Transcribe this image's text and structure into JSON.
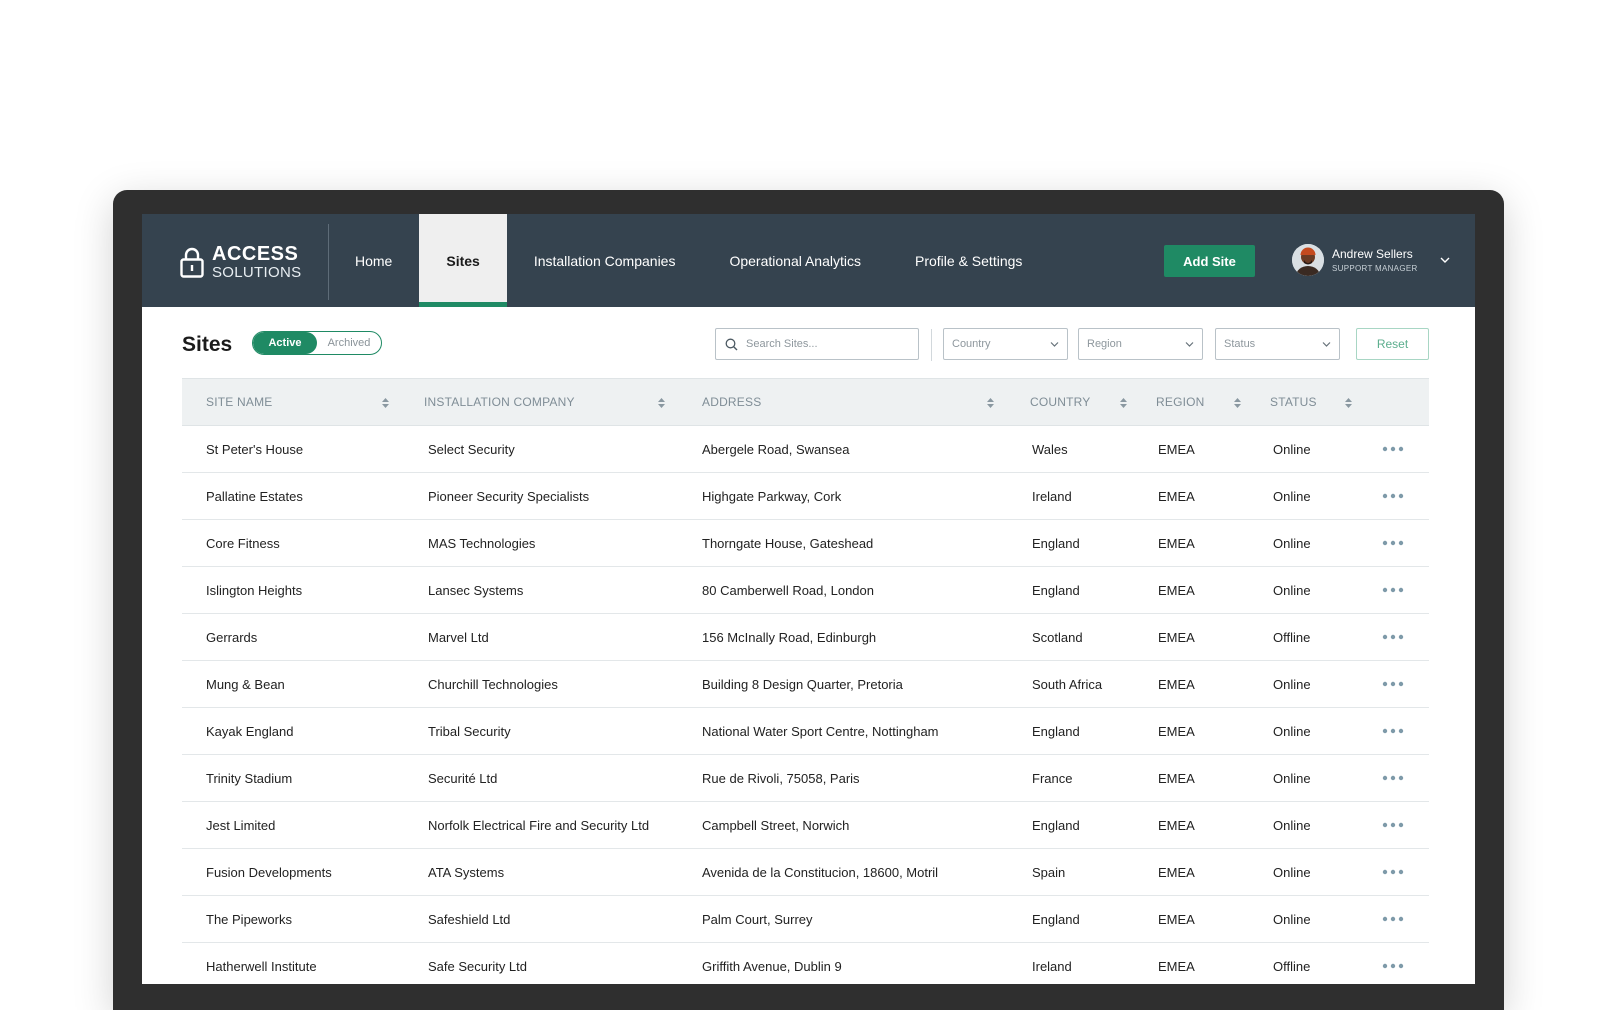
{
  "brand": {
    "line1": "ACCESS",
    "line2": "SOLUTIONS"
  },
  "nav": {
    "items": [
      {
        "label": "Home",
        "active": false
      },
      {
        "label": "Sites",
        "active": true
      },
      {
        "label": "Installation Companies",
        "active": false
      },
      {
        "label": "Operational Analytics",
        "active": false
      },
      {
        "label": "Profile & Settings",
        "active": false
      }
    ],
    "add_label": "Add Site"
  },
  "user": {
    "name": "Andrew Sellers",
    "role": "SUPPORT MANAGER"
  },
  "toolbar": {
    "title": "Sites",
    "toggle": [
      "Active",
      "Archived"
    ],
    "search_placeholder": "Search Sites...",
    "filters": [
      "Country",
      "Region",
      "Status"
    ],
    "reset_label": "Reset"
  },
  "table": {
    "headers": [
      "SITE NAME",
      "INSTALLATION COMPANY",
      "ADDRESS",
      "COUNTRY",
      "REGION",
      "STATUS"
    ],
    "rows": [
      [
        "St Peter's House",
        "Select Security",
        "Abergele Road, Swansea",
        "Wales",
        "EMEA",
        "Online"
      ],
      [
        "Pallatine Estates",
        "Pioneer Security Specialists",
        "Highgate Parkway, Cork",
        "Ireland",
        "EMEA",
        "Online"
      ],
      [
        "Core Fitness",
        "MAS Technologies",
        "Thorngate House, Gateshead",
        "England",
        "EMEA",
        "Online"
      ],
      [
        "Islington Heights",
        "Lansec Systems",
        "80 Camberwell Road, London",
        "England",
        "EMEA",
        "Online"
      ],
      [
        "Gerrards",
        "Marvel Ltd",
        "156 McInally Road, Edinburgh",
        "Scotland",
        "EMEA",
        "Offline"
      ],
      [
        "Mung & Bean",
        "Churchill Technologies",
        "Building 8 Design Quarter, Pretoria",
        "South Africa",
        "EMEA",
        "Online"
      ],
      [
        "Kayak England",
        "Tribal Security",
        "National Water Sport Centre, Nottingham",
        "England",
        "EMEA",
        "Online"
      ],
      [
        "Trinity Stadium",
        "Securité Ltd",
        "Rue de Rivoli, 75058, Paris",
        "France",
        "EMEA",
        "Online"
      ],
      [
        "Jest Limited",
        "Norfolk Electrical Fire and Security Ltd",
        "Campbell Street, Norwich",
        "England",
        "EMEA",
        "Online"
      ],
      [
        "Fusion Developments",
        "ATA Systems",
        "Avenida de la Constitucion, 18600, Motril",
        "Spain",
        "EMEA",
        "Online"
      ],
      [
        "The Pipeworks",
        "Safeshield Ltd",
        "Palm Court, Surrey",
        "England",
        "EMEA",
        "Online"
      ],
      [
        "Hatherwell Institute",
        "Safe Security Ltd",
        "Griffith Avenue, Dublin 9",
        "Ireland",
        "EMEA",
        "Offline"
      ]
    ]
  },
  "colors": {
    "nav_bg": "#35434f",
    "accent": "#1f8a64",
    "header_bg": "#eef1f2"
  }
}
